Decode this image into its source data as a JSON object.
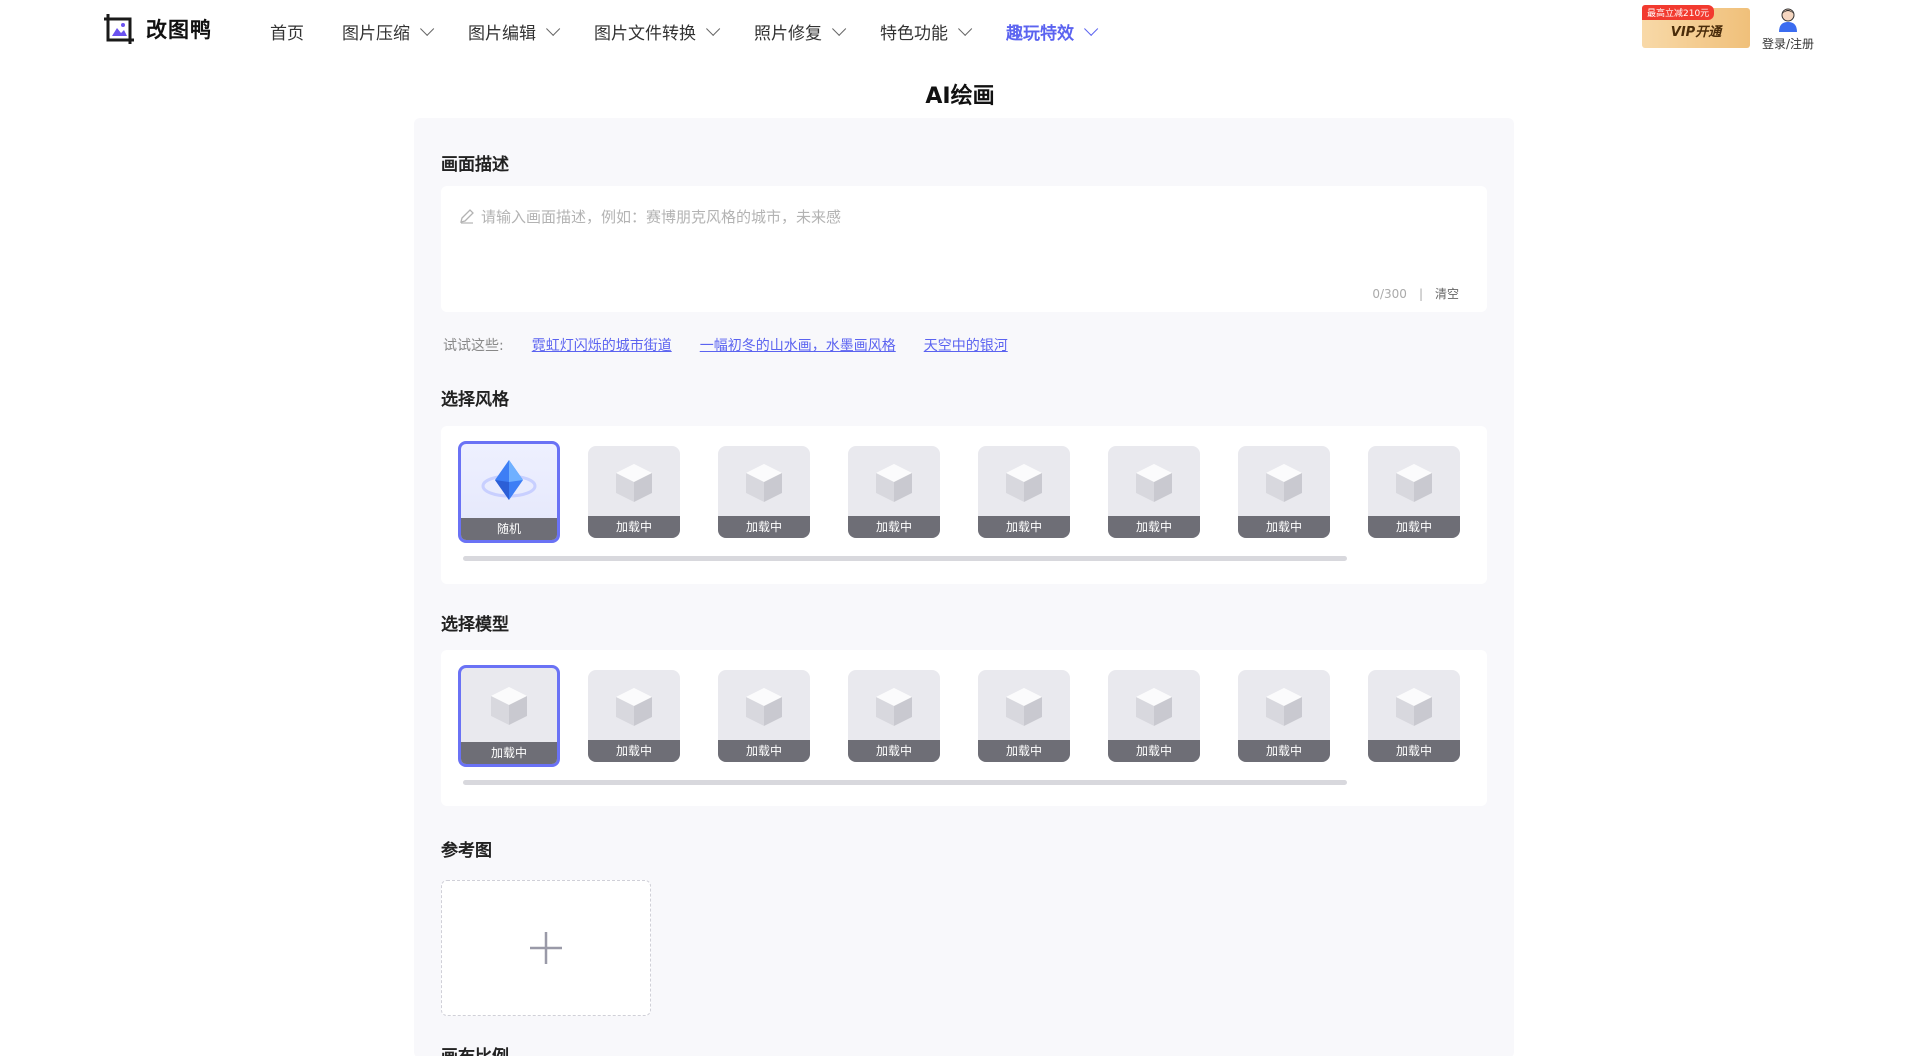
{
  "brand": {
    "name": "改图鸭"
  },
  "nav": [
    {
      "label": "首页",
      "dropdown": false,
      "active": false
    },
    {
      "label": "图片压缩",
      "dropdown": true,
      "active": false
    },
    {
      "label": "图片编辑",
      "dropdown": true,
      "active": false
    },
    {
      "label": "图片文件转换",
      "dropdown": true,
      "active": false
    },
    {
      "label": "照片修复",
      "dropdown": true,
      "active": false
    },
    {
      "label": "特色功能",
      "dropdown": true,
      "active": false
    },
    {
      "label": "趣玩特效",
      "dropdown": true,
      "active": true
    }
  ],
  "vip": {
    "badge": "最高立减210元",
    "label": "VIP开通"
  },
  "user": {
    "label": "登录/注册"
  },
  "page": {
    "title": "AI绘画"
  },
  "description": {
    "label": "画面描述",
    "placeholder": "请输入画面描述，例如：赛博朋克风格的城市，未来感",
    "value": "",
    "counter": "0/300",
    "separator": "|",
    "clear_label": "清空"
  },
  "suggestions": {
    "prefix": "试试这些:",
    "items": [
      "霓虹灯闪烁的城市街道",
      "一幅初冬的山水画，水墨画风格",
      "天空中的银河"
    ]
  },
  "style": {
    "label": "选择风格",
    "cards": [
      "随机",
      "加载中",
      "加载中",
      "加载中",
      "加载中",
      "加载中",
      "加载中",
      "加载中"
    ],
    "selected_index": 0
  },
  "model": {
    "label": "选择模型",
    "cards": [
      "加载中",
      "加载中",
      "加载中",
      "加载中",
      "加载中",
      "加载中",
      "加载中",
      "加载中"
    ],
    "selected_index": 0
  },
  "reference": {
    "label": "参考图"
  },
  "ratio": {
    "label": "画布比例"
  },
  "colors": {
    "accent": "#5b63f0",
    "selected_border": "#6a72f5",
    "card_caption": "#6e6e76"
  }
}
